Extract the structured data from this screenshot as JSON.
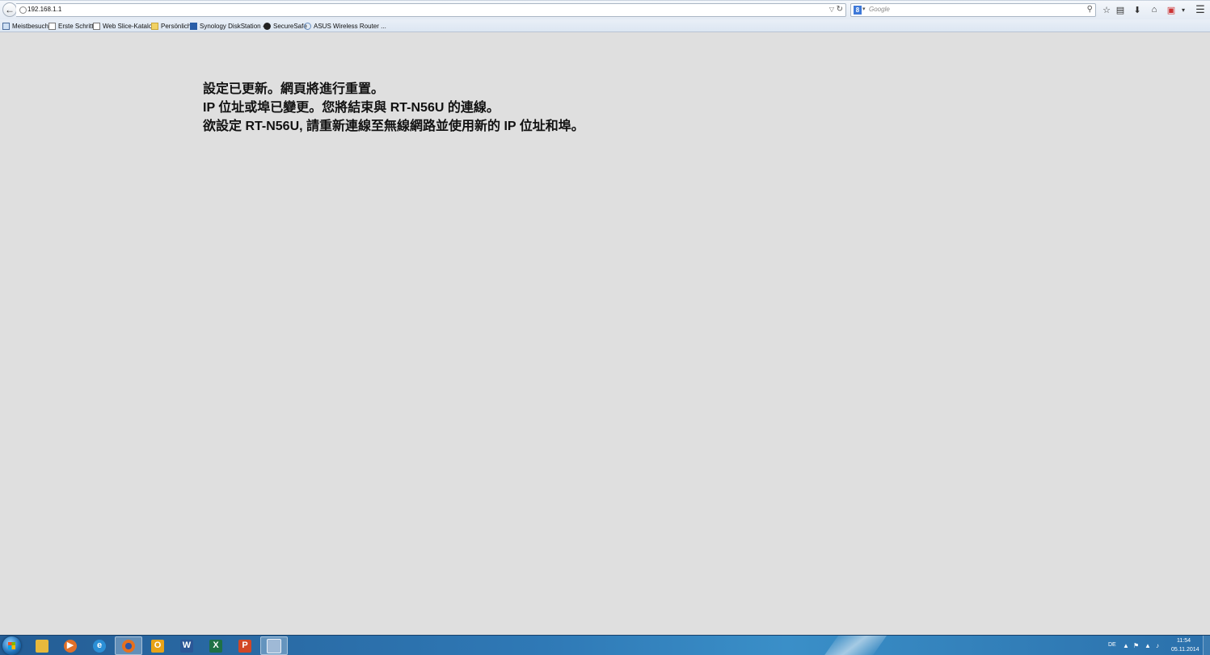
{
  "browser": {
    "url": "192.168.1.1",
    "search_placeholder": "Google",
    "search_engine_letter": "8"
  },
  "bookmarks": [
    {
      "label": "Meistbesucht",
      "icon": "most-visited-icon"
    },
    {
      "label": "Erste Schritte",
      "icon": "page-icon"
    },
    {
      "label": "Web Slice-Katalog",
      "icon": "page-icon"
    },
    {
      "label": "Persönlich",
      "icon": "folder-icon"
    },
    {
      "label": "Synology DiskStation -...",
      "icon": "synology-icon"
    },
    {
      "label": "SecureSafe",
      "icon": "securesafe-icon"
    },
    {
      "label": "ASUS Wireless Router ...",
      "icon": "asus-icon"
    }
  ],
  "page": {
    "line1": "設定已更新。網頁將進行重置。",
    "line2": "IP 位址或埠已變更。您將結束與 RT-N56U 的連線。",
    "line3": "欲設定 RT-N56U, 請重新連線至無線網路並使用新的 IP 位址和埠。"
  },
  "taskbar": {
    "apps": [
      {
        "name": "explorer",
        "icon": "folder-icon",
        "color": "#e7b93c"
      },
      {
        "name": "media-player",
        "icon": "play-icon",
        "color": "#e0702a"
      },
      {
        "name": "internet-explorer",
        "icon": "ie-icon",
        "color": "#2b8fd6"
      },
      {
        "name": "firefox",
        "icon": "firefox-icon",
        "color": "#e5701f"
      },
      {
        "name": "outlook",
        "icon": "outlook-icon",
        "color": "#e8a317",
        "glyph": "O"
      },
      {
        "name": "word",
        "icon": "word-icon",
        "color": "#2b5797",
        "glyph": "W"
      },
      {
        "name": "excel",
        "icon": "excel-icon",
        "color": "#1e7145",
        "glyph": "X"
      },
      {
        "name": "powerpoint",
        "icon": "powerpoint-icon",
        "color": "#d24726",
        "glyph": "P"
      },
      {
        "name": "remote-desktop",
        "icon": "remote-desktop-icon",
        "color": "#9fb9d6"
      }
    ],
    "language": "DE",
    "time": "11:54",
    "date": "05.11.2014"
  }
}
